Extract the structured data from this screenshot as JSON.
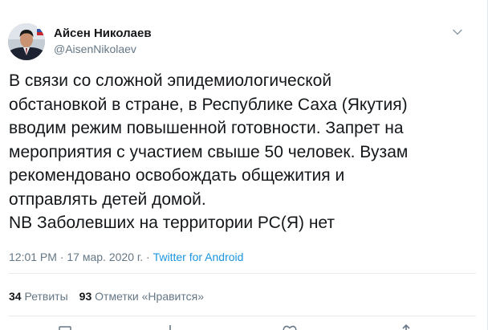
{
  "author": {
    "name": "Айсен Николаев",
    "handle": "@AisenNikolaev"
  },
  "tweet": {
    "lines": [
      "В связи со сложной эпидемиологической",
      "обстановкой в стране, в Республике Саха (Якутия)",
      "вводим режим повышенной готовности. Запрет на",
      "мероприятия с участием свыше 50 человек. Вузам",
      "рекомендовано освобождать общежития и",
      "отправлять детей домой.",
      "NB Заболевших на территории РС(Я) нет"
    ]
  },
  "meta": {
    "time": "12:01 PM",
    "separator": " · ",
    "date": "17 мар. 2020 г.",
    "separator2": " · ",
    "source": "Twitter for Android"
  },
  "stats": {
    "retweets_count": "34",
    "retweets_label": "Ретвиты",
    "likes_count": "93",
    "likes_label": "Отметки «Нравится»"
  },
  "icons": {
    "menu": "chevron-down-icon",
    "actions": [
      "reply-icon",
      "retweet-icon",
      "like-icon",
      "share-icon"
    ]
  },
  "colors": {
    "text": "#14171a",
    "secondary": "#657786",
    "link": "#1b95e0",
    "divider": "#e6ecf0"
  }
}
